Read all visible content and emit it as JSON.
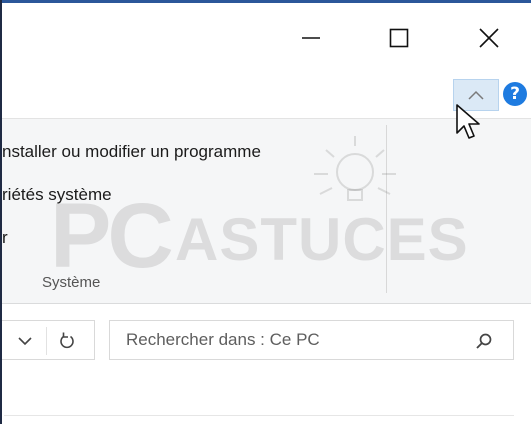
{
  "title_bar": {
    "minimize_icon": "minimize-icon",
    "maximize_icon": "maximize-icon",
    "close_icon": "close-icon"
  },
  "ribbon_header": {
    "collapse_icon": "chevron-up-icon",
    "help_label": "?"
  },
  "ribbon": {
    "items": [
      {
        "label": "nstaller ou modifier un programme"
      },
      {
        "label": "riétés système"
      },
      {
        "label": "r"
      }
    ],
    "group_label": "Système"
  },
  "watermark": {
    "brand_pc": "PC",
    "brand_astuces": "ASTUCES"
  },
  "navigation": {
    "dropdown_icon": "chevron-down-icon",
    "refresh_icon": "refresh-icon",
    "search_placeholder": "Rechercher dans : Ce PC",
    "search_icon": "search-icon"
  },
  "colors": {
    "accent_border": "#2b579a",
    "collapse_highlight": "#dbe9f6",
    "help_blue": "#1e7be0",
    "ribbon_bg": "#f5f6f7"
  }
}
